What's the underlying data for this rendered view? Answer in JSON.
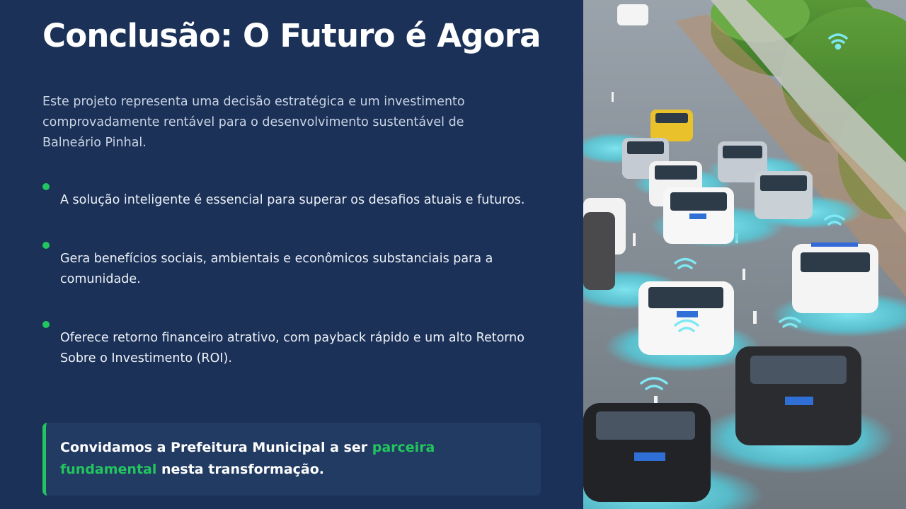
{
  "slide": {
    "title": "Conclusão: O Futuro é Agora",
    "intro": "Este projeto representa uma decisão estratégica e um investimento comprovadamente rentável para o desenvolvimento sustentável de Balneário Pinhal.",
    "bullets": [
      "A solução inteligente é essencial para superar os desafios atuais e futuros.",
      "Gera benefícios sociais, ambientais e econômicos substanciais para a comunidade.",
      "Oferece retorno financeiro atrativo, com payback rápido e um alto Retorno Sobre o Investimento (ROI)."
    ],
    "callout": {
      "before": "Convidamos a Prefeitura Municipal a ser ",
      "highlight": "parceira fundamental",
      "after": " nesta transformação."
    }
  },
  "colors": {
    "background": "#1b3158",
    "accent": "#22c55e",
    "callout_bg": "#223b62",
    "glow": "#5fd6e6"
  },
  "image": {
    "subject": "smart-road-autonomous-cars-illustration"
  }
}
